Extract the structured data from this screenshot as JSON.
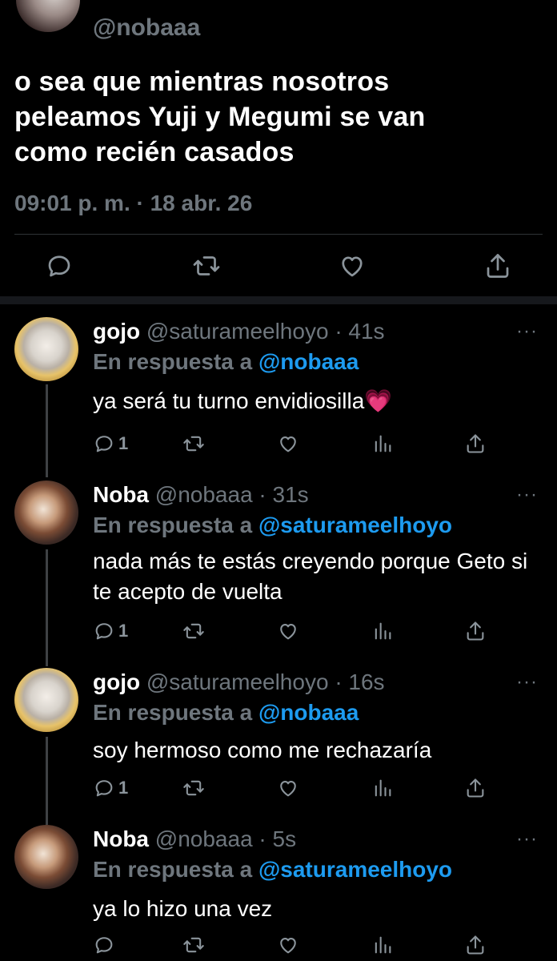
{
  "main_tweet": {
    "handle": "@nobaaa",
    "text_lines": [
      "o sea que mientras nosotros",
      "peleamos Yuji y Megumi se van",
      "como recién casados"
    ],
    "timestamp": "09:01 p. m. · 18 abr. 26",
    "actions": [
      "reply-icon",
      "retweet-icon",
      "like-icon",
      "share-icon"
    ]
  },
  "replies": [
    {
      "name": "gojo",
      "handle": "@saturameelhoyo",
      "time": "· 41s",
      "reply_prefix": "En respuesta a",
      "reply_to": "@nobaaa",
      "text": "ya será tu turno envidiosilla💗",
      "reply_count": "1"
    },
    {
      "name": "Noba",
      "handle": "@nobaaa",
      "time": "· 31s",
      "reply_prefix": "En respuesta a",
      "reply_to": "@saturameelhoyo",
      "text": "nada más te estás creyendo porque Geto si te acepto de vuelta",
      "reply_count": "1"
    },
    {
      "name": "gojo",
      "handle": "@saturameelhoyo",
      "time": "· 16s",
      "reply_prefix": "En respuesta a",
      "reply_to": "@nobaaa",
      "text": "soy hermoso como me rechazaría",
      "reply_count": "1"
    },
    {
      "name": "Noba",
      "handle": "@nobaaa",
      "time": "· 5s",
      "reply_prefix": "En respuesta a",
      "reply_to": "@saturameelhoyo",
      "text": "ya lo hizo una vez",
      "reply_count": ""
    }
  ],
  "more_label": "···",
  "colors": {
    "background": "#000000",
    "muted": "#6e767d",
    "link": "#1d9bf0",
    "divider": "#2f3336"
  }
}
